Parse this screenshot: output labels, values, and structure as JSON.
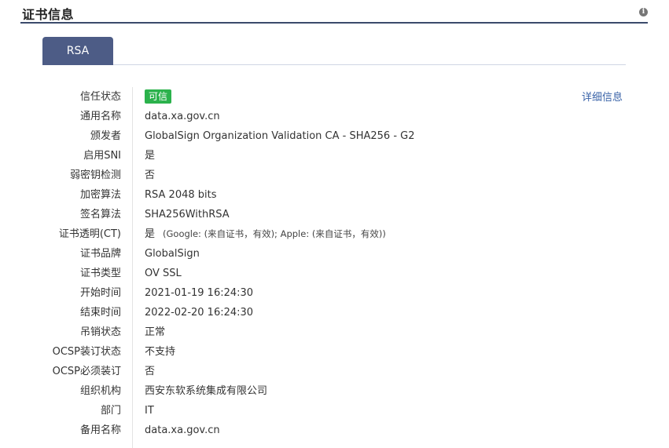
{
  "header": {
    "title": "证书信息",
    "info_icon_glyph": "i"
  },
  "tabs": [
    {
      "label": "RSA",
      "active": true
    }
  ],
  "details_link": "详细信息",
  "colors": {
    "accent": "#4d5c86",
    "trusted_badge": "#2bb24c",
    "link": "#3a63a8"
  },
  "rows": {
    "trust_status": {
      "label": "信任状态",
      "value": "可信"
    },
    "common_name": {
      "label": "通用名称",
      "value": "data.xa.gov.cn"
    },
    "issuer": {
      "label": "颁发者",
      "value": "GlobalSign Organization Validation CA - SHA256 - G2"
    },
    "sni": {
      "label": "启用SNI",
      "value": "是"
    },
    "weak_key": {
      "label": "弱密钥检测",
      "value": "否"
    },
    "encryption": {
      "label": "加密算法",
      "value": "RSA 2048 bits"
    },
    "signature": {
      "label": "签名算法",
      "value": "SHA256WithRSA"
    },
    "ct": {
      "label": "证书透明(CT)",
      "value": "是",
      "note": "(Google: (来自证书，有效); Apple: (来自证书，有效))"
    },
    "brand": {
      "label": "证书品牌",
      "value": "GlobalSign"
    },
    "type": {
      "label": "证书类型",
      "value": "OV SSL"
    },
    "start_time": {
      "label": "开始时间",
      "value": "2021-01-19 16:24:30"
    },
    "end_time": {
      "label": "结束时间",
      "value": "2022-02-20 16:24:30"
    },
    "revocation": {
      "label": "吊销状态",
      "value": "正常"
    },
    "ocsp_stapling": {
      "label": "OCSP装订状态",
      "value": "不支持"
    },
    "ocsp_must_staple": {
      "label": "OCSP必须装订",
      "value": "否"
    },
    "organization": {
      "label": "组织机构",
      "value": "西安东软系统集成有限公司"
    },
    "department": {
      "label": "部门",
      "value": "IT"
    },
    "alt_name": {
      "label": "备用名称",
      "value": "data.xa.gov.cn"
    }
  }
}
